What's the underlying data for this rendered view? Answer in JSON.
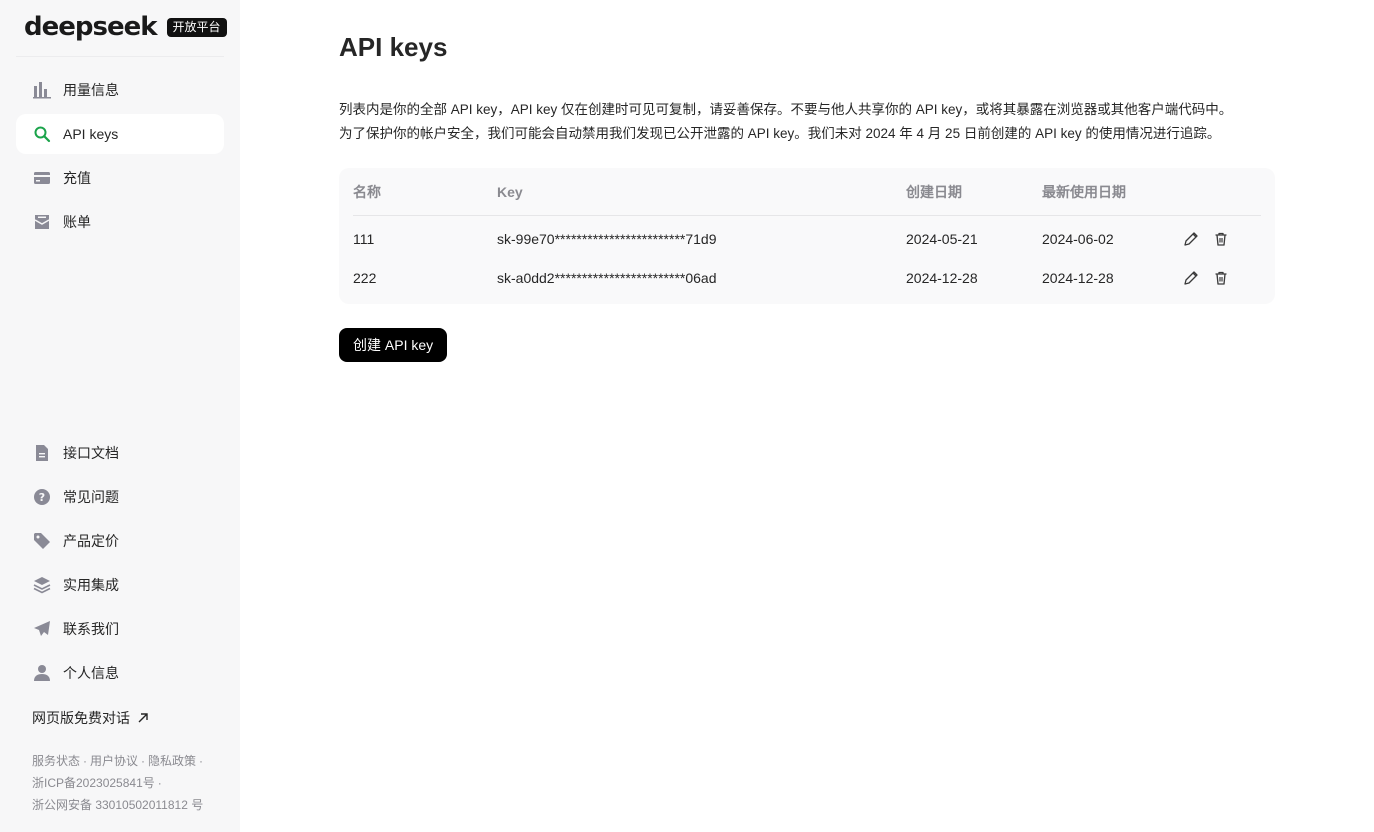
{
  "brand": {
    "name": "deepseek",
    "badge": "开放平台"
  },
  "sidebar": {
    "top_items": [
      {
        "label": "用量信息",
        "icon": "bar-chart-icon",
        "active": false
      },
      {
        "label": "API keys",
        "icon": "search-key-icon",
        "active": true
      },
      {
        "label": "充值",
        "icon": "credit-card-icon",
        "active": false
      },
      {
        "label": "账单",
        "icon": "invoice-icon",
        "active": false
      }
    ],
    "bottom_items": [
      {
        "label": "接口文档",
        "icon": "document-icon"
      },
      {
        "label": "常见问题",
        "icon": "question-icon"
      },
      {
        "label": "产品定价",
        "icon": "price-tag-icon"
      },
      {
        "label": "实用集成",
        "icon": "layers-icon"
      },
      {
        "label": "联系我们",
        "icon": "paper-plane-icon"
      },
      {
        "label": "个人信息",
        "icon": "user-icon"
      }
    ],
    "free_chat": "网页版免费对话",
    "footer": {
      "service_status": "服务状态",
      "user_agreement": "用户协议",
      "privacy_policy": "隐私政策",
      "icp": "浙ICP备2023025841号",
      "police": "浙公网安备 33010502011812 号"
    }
  },
  "main": {
    "title": "API keys",
    "description_line1": "列表内是你的全部 API key，API key 仅在创建时可见可复制，请妥善保存。不要与他人共享你的 API key，或将其暴露在浏览器或其他客户端代码中。",
    "description_line2": "为了保护你的帐户安全，我们可能会自动禁用我们发现已公开泄露的 API key。我们未对 2024 年 4 月 25 日前创建的 API key 的使用情况进行追踪。",
    "table": {
      "headers": {
        "name": "名称",
        "key": "Key",
        "created": "创建日期",
        "last_used": "最新使用日期"
      },
      "rows": [
        {
          "name": "111",
          "key": "sk-99e70************************71d9",
          "created": "2024-05-21",
          "last_used": "2024-06-02"
        },
        {
          "name": "222",
          "key": "sk-a0dd2************************06ad",
          "created": "2024-12-28",
          "last_used": "2024-12-28"
        }
      ]
    },
    "create_button": "创建 API key"
  },
  "colors": {
    "accent": "#1aa34a",
    "icon_gray": "#8a8a96",
    "sidebar_bg": "#f7f7f8"
  }
}
